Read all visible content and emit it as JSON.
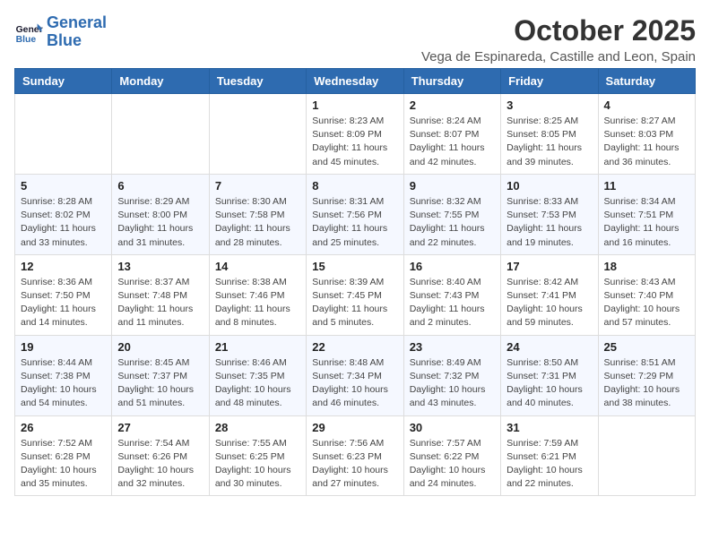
{
  "logo": {
    "line1": "General",
    "line2": "Blue"
  },
  "title": "October 2025",
  "location": "Vega de Espinareda, Castille and Leon, Spain",
  "weekdays": [
    "Sunday",
    "Monday",
    "Tuesday",
    "Wednesday",
    "Thursday",
    "Friday",
    "Saturday"
  ],
  "weeks": [
    [
      {
        "day": "",
        "info": ""
      },
      {
        "day": "",
        "info": ""
      },
      {
        "day": "",
        "info": ""
      },
      {
        "day": "1",
        "info": "Sunrise: 8:23 AM\nSunset: 8:09 PM\nDaylight: 11 hours\nand 45 minutes."
      },
      {
        "day": "2",
        "info": "Sunrise: 8:24 AM\nSunset: 8:07 PM\nDaylight: 11 hours\nand 42 minutes."
      },
      {
        "day": "3",
        "info": "Sunrise: 8:25 AM\nSunset: 8:05 PM\nDaylight: 11 hours\nand 39 minutes."
      },
      {
        "day": "4",
        "info": "Sunrise: 8:27 AM\nSunset: 8:03 PM\nDaylight: 11 hours\nand 36 minutes."
      }
    ],
    [
      {
        "day": "5",
        "info": "Sunrise: 8:28 AM\nSunset: 8:02 PM\nDaylight: 11 hours\nand 33 minutes."
      },
      {
        "day": "6",
        "info": "Sunrise: 8:29 AM\nSunset: 8:00 PM\nDaylight: 11 hours\nand 31 minutes."
      },
      {
        "day": "7",
        "info": "Sunrise: 8:30 AM\nSunset: 7:58 PM\nDaylight: 11 hours\nand 28 minutes."
      },
      {
        "day": "8",
        "info": "Sunrise: 8:31 AM\nSunset: 7:56 PM\nDaylight: 11 hours\nand 25 minutes."
      },
      {
        "day": "9",
        "info": "Sunrise: 8:32 AM\nSunset: 7:55 PM\nDaylight: 11 hours\nand 22 minutes."
      },
      {
        "day": "10",
        "info": "Sunrise: 8:33 AM\nSunset: 7:53 PM\nDaylight: 11 hours\nand 19 minutes."
      },
      {
        "day": "11",
        "info": "Sunrise: 8:34 AM\nSunset: 7:51 PM\nDaylight: 11 hours\nand 16 minutes."
      }
    ],
    [
      {
        "day": "12",
        "info": "Sunrise: 8:36 AM\nSunset: 7:50 PM\nDaylight: 11 hours\nand 14 minutes."
      },
      {
        "day": "13",
        "info": "Sunrise: 8:37 AM\nSunset: 7:48 PM\nDaylight: 11 hours\nand 11 minutes."
      },
      {
        "day": "14",
        "info": "Sunrise: 8:38 AM\nSunset: 7:46 PM\nDaylight: 11 hours\nand 8 minutes."
      },
      {
        "day": "15",
        "info": "Sunrise: 8:39 AM\nSunset: 7:45 PM\nDaylight: 11 hours\nand 5 minutes."
      },
      {
        "day": "16",
        "info": "Sunrise: 8:40 AM\nSunset: 7:43 PM\nDaylight: 11 hours\nand 2 minutes."
      },
      {
        "day": "17",
        "info": "Sunrise: 8:42 AM\nSunset: 7:41 PM\nDaylight: 10 hours\nand 59 minutes."
      },
      {
        "day": "18",
        "info": "Sunrise: 8:43 AM\nSunset: 7:40 PM\nDaylight: 10 hours\nand 57 minutes."
      }
    ],
    [
      {
        "day": "19",
        "info": "Sunrise: 8:44 AM\nSunset: 7:38 PM\nDaylight: 10 hours\nand 54 minutes."
      },
      {
        "day": "20",
        "info": "Sunrise: 8:45 AM\nSunset: 7:37 PM\nDaylight: 10 hours\nand 51 minutes."
      },
      {
        "day": "21",
        "info": "Sunrise: 8:46 AM\nSunset: 7:35 PM\nDaylight: 10 hours\nand 48 minutes."
      },
      {
        "day": "22",
        "info": "Sunrise: 8:48 AM\nSunset: 7:34 PM\nDaylight: 10 hours\nand 46 minutes."
      },
      {
        "day": "23",
        "info": "Sunrise: 8:49 AM\nSunset: 7:32 PM\nDaylight: 10 hours\nand 43 minutes."
      },
      {
        "day": "24",
        "info": "Sunrise: 8:50 AM\nSunset: 7:31 PM\nDaylight: 10 hours\nand 40 minutes."
      },
      {
        "day": "25",
        "info": "Sunrise: 8:51 AM\nSunset: 7:29 PM\nDaylight: 10 hours\nand 38 minutes."
      }
    ],
    [
      {
        "day": "26",
        "info": "Sunrise: 7:52 AM\nSunset: 6:28 PM\nDaylight: 10 hours\nand 35 minutes."
      },
      {
        "day": "27",
        "info": "Sunrise: 7:54 AM\nSunset: 6:26 PM\nDaylight: 10 hours\nand 32 minutes."
      },
      {
        "day": "28",
        "info": "Sunrise: 7:55 AM\nSunset: 6:25 PM\nDaylight: 10 hours\nand 30 minutes."
      },
      {
        "day": "29",
        "info": "Sunrise: 7:56 AM\nSunset: 6:23 PM\nDaylight: 10 hours\nand 27 minutes."
      },
      {
        "day": "30",
        "info": "Sunrise: 7:57 AM\nSunset: 6:22 PM\nDaylight: 10 hours\nand 24 minutes."
      },
      {
        "day": "31",
        "info": "Sunrise: 7:59 AM\nSunset: 6:21 PM\nDaylight: 10 hours\nand 22 minutes."
      },
      {
        "day": "",
        "info": ""
      }
    ]
  ]
}
